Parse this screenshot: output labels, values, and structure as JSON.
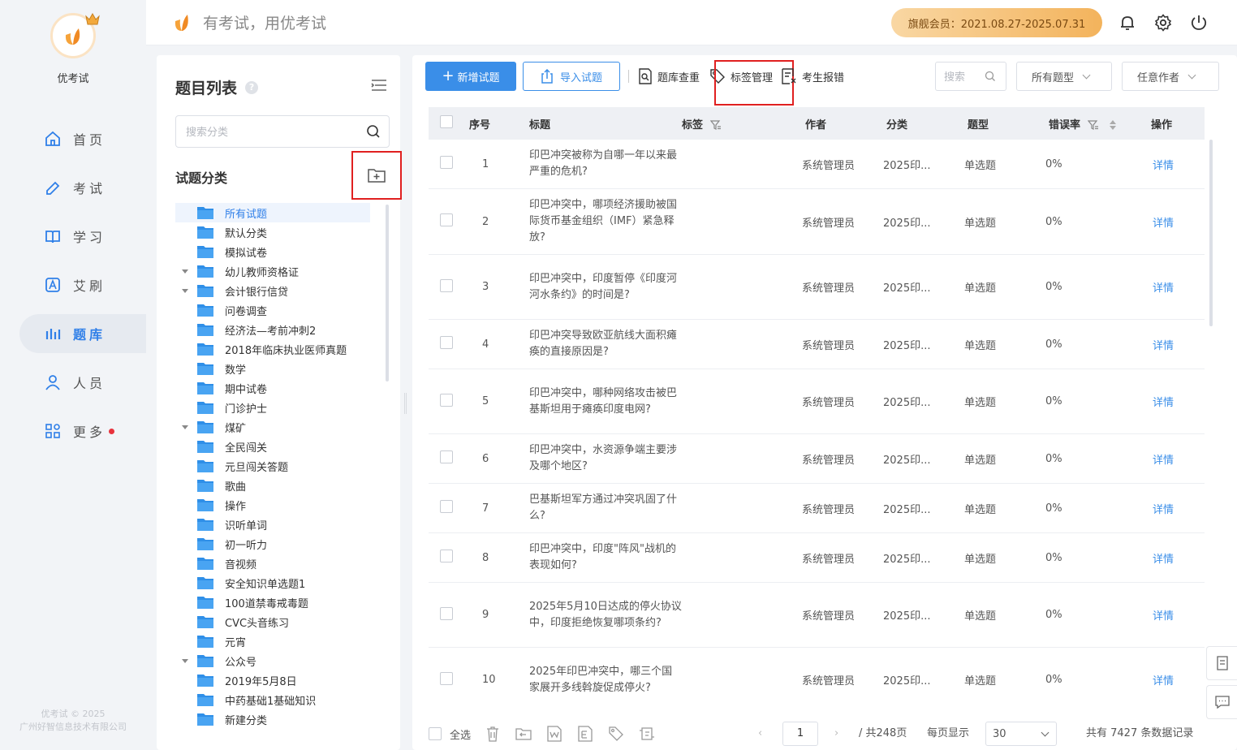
{
  "app": {
    "name": "优考试",
    "slogan": "有考试，用优考试",
    "copyright_line1": "优考试 © 2025",
    "copyright_line2": "广州好智信息技术有限公司"
  },
  "header": {
    "vip_label": "旗舰会员：2021.08.27-2025.07.31"
  },
  "nav": {
    "items": [
      {
        "label": "首页",
        "icon": "home-icon"
      },
      {
        "label": "考试",
        "icon": "pen-icon"
      },
      {
        "label": "学习",
        "icon": "book-icon"
      },
      {
        "label": "艾刷",
        "icon": "letter-a-icon"
      },
      {
        "label": "题库",
        "icon": "bars-chart-icon",
        "active": true
      },
      {
        "label": "人员",
        "icon": "person-icon"
      },
      {
        "label": "更多",
        "icon": "grid-icon",
        "has_dot": true
      }
    ]
  },
  "category": {
    "title": "题目列表",
    "help": "?",
    "search_placeholder": "搜索分类",
    "subhead": "试题分类",
    "items": [
      {
        "label": "所有试题",
        "active": true
      },
      {
        "label": "默认分类"
      },
      {
        "label": "模拟试卷"
      },
      {
        "label": "幼儿教师资格证",
        "expandable": true
      },
      {
        "label": "会计银行信贷",
        "expandable": true
      },
      {
        "label": "问卷调查"
      },
      {
        "label": "经济法—考前冲刺2"
      },
      {
        "label": "2018年临床执业医师真题"
      },
      {
        "label": "数学"
      },
      {
        "label": "期中试卷"
      },
      {
        "label": "门诊护士"
      },
      {
        "label": "煤矿",
        "expandable": true
      },
      {
        "label": "全民闯关"
      },
      {
        "label": "元旦闯关答题"
      },
      {
        "label": "歌曲"
      },
      {
        "label": "操作"
      },
      {
        "label": "识听单词"
      },
      {
        "label": "初一听力"
      },
      {
        "label": "音视频"
      },
      {
        "label": "安全知识单选题1"
      },
      {
        "label": "100道禁毒戒毒题"
      },
      {
        "label": "CVC头音练习"
      },
      {
        "label": "元宵"
      },
      {
        "label": "公众号",
        "expandable": true
      },
      {
        "label": "2019年5月8日"
      },
      {
        "label": "中药基础1基础知识"
      },
      {
        "label": "新建分类"
      }
    ]
  },
  "toolbar": {
    "add_label": "新增试题",
    "import_label": "导入试题",
    "dedupe_label": "题库查重",
    "tag_label": "标签管理",
    "report_label": "考生报错",
    "search_placeholder": "搜索",
    "type_filter": "所有题型",
    "author_filter": "任意作者"
  },
  "table": {
    "headers": {
      "seq": "序号",
      "title": "标题",
      "tag": "标签",
      "author": "作者",
      "category": "分类",
      "type": "题型",
      "error_rate": "错误率",
      "action": "操作"
    },
    "rows": [
      {
        "seq": "1",
        "title": "印巴冲突被称为自哪一年以来最严重的危机?",
        "author": "系统管理员",
        "category": "2025印...",
        "type": "单选题",
        "error_rate": "0%",
        "action": "详情"
      },
      {
        "seq": "2",
        "title": "印巴冲突中，哪项经济援助被国际货币基金组织（IMF）紧急释放?",
        "author": "系统管理员",
        "category": "2025印...",
        "type": "单选题",
        "error_rate": "0%",
        "action": "详情"
      },
      {
        "seq": "3",
        "title": "印巴冲突中，印度暂停《印度河河水条约》的时间是?",
        "author": "系统管理员",
        "category": "2025印...",
        "type": "单选题",
        "error_rate": "0%",
        "action": "详情"
      },
      {
        "seq": "4",
        "title": "印巴冲突导致欧亚航线大面积瘫痪的直接原因是?",
        "author": "系统管理员",
        "category": "2025印...",
        "type": "单选题",
        "error_rate": "0%",
        "action": "详情"
      },
      {
        "seq": "5",
        "title": "印巴冲突中，哪种网络攻击被巴基斯坦用于瘫痪印度电网?",
        "author": "系统管理员",
        "category": "2025印...",
        "type": "单选题",
        "error_rate": "0%",
        "action": "详情"
      },
      {
        "seq": "6",
        "title": "印巴冲突中，水资源争端主要涉及哪个地区?",
        "author": "系统管理员",
        "category": "2025印...",
        "type": "单选题",
        "error_rate": "0%",
        "action": "详情"
      },
      {
        "seq": "7",
        "title": "巴基斯坦军方通过冲突巩固了什么?",
        "author": "系统管理员",
        "category": "2025印...",
        "type": "单选题",
        "error_rate": "0%",
        "action": "详情"
      },
      {
        "seq": "8",
        "title": "印巴冲突中，印度\"阵风\"战机的表现如何?",
        "author": "系统管理员",
        "category": "2025印...",
        "type": "单选题",
        "error_rate": "0%",
        "action": "详情"
      },
      {
        "seq": "9",
        "title": "2025年5月10日达成的停火协议中，印度拒绝恢复哪项条约?",
        "author": "系统管理员",
        "category": "2025印...",
        "type": "单选题",
        "error_rate": "0%",
        "action": "详情"
      },
      {
        "seq": "10",
        "title": "2025年印巴冲突中，哪三个国家展开多线斡旋促成停火?",
        "author": "系统管理员",
        "category": "2025印...",
        "type": "单选题",
        "error_rate": "0%",
        "action": "详情"
      }
    ]
  },
  "footer": {
    "select_all": "全选",
    "current_page": "1",
    "total_pages": "/ 共248页",
    "per_page_label": "每页显示",
    "per_page": "30",
    "total_records": "共有 7427 条数据记录"
  }
}
